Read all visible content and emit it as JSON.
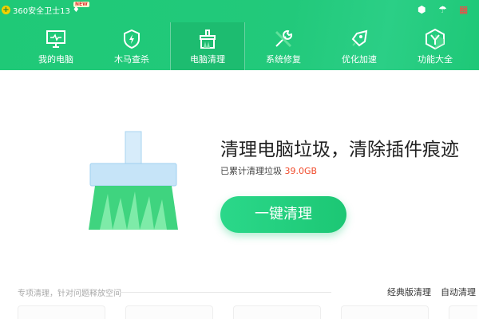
{
  "app": {
    "title": "360安全卫士13",
    "badge": "NEW"
  },
  "tabs": [
    {
      "label": "我的电脑"
    },
    {
      "label": "木马查杀"
    },
    {
      "label": "电脑清理"
    },
    {
      "label": "系统修复"
    },
    {
      "label": "优化加速"
    },
    {
      "label": "功能大全"
    }
  ],
  "main": {
    "heading": "清理电脑垃圾，清除插件痕迹",
    "cleaned_prefix": "已累计清理垃圾",
    "cleaned_value": "39.0GB",
    "button": "一键清理"
  },
  "section": {
    "label": "专项清理，针对问题释放空间",
    "classic": "经典版清理",
    "auto": "自动清理"
  },
  "colors": {
    "brand": "#1fc977",
    "accent": "#f04a2a"
  }
}
